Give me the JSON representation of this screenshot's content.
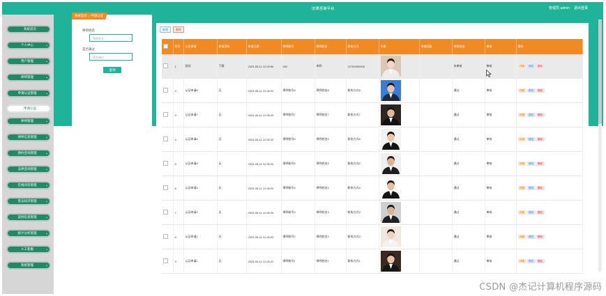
{
  "header": {
    "site_title": "法律咨询平台",
    "admin_label": "管理员 admin",
    "logout": "退出登录"
  },
  "sidebar": {
    "items": [
      {
        "label": "系统首页",
        "chevron": false,
        "active": false
      },
      {
        "label": "个人中心",
        "chevron": true,
        "active": false
      },
      {
        "label": "用户管理",
        "chevron": true,
        "active": false
      },
      {
        "label": "律师管理",
        "chevron": true,
        "active": false
      },
      {
        "label": "申请认证管理",
        "chevron": true,
        "active": false
      },
      {
        "label": "申请认证",
        "chevron": false,
        "active": true
      },
      {
        "label": "律师管理",
        "chevron": true,
        "active": false
      },
      {
        "label": "律师信息管理",
        "chevron": true,
        "active": false
      },
      {
        "label": "预约咨询管理",
        "chevron": true,
        "active": false
      },
      {
        "label": "法律咨询管理",
        "chevron": true,
        "active": false
      },
      {
        "label": "在线问答管理",
        "chevron": true,
        "active": false
      },
      {
        "label": "普法知识管理",
        "chevron": true,
        "active": false
      },
      {
        "label": "案例信息管理",
        "chevron": true,
        "active": false
      },
      {
        "label": "统计分析管理",
        "chevron": true,
        "active": false
      },
      {
        "label": "人工客服",
        "chevron": true,
        "active": false
      },
      {
        "label": "系统管理",
        "chevron": true,
        "active": false
      }
    ]
  },
  "breadcrumb": {
    "home": "系统首页",
    "separator": "/",
    "current": "申请认证"
  },
  "filters": {
    "field1_label": "律师姓名",
    "field1_placeholder": "律师姓名",
    "field2_label": "是否通过",
    "field2_placeholder": "是否通过",
    "search_button": "查询"
  },
  "toolbar": {
    "add": "新增",
    "delete": "删除"
  },
  "table": {
    "headers": [
      "",
      "序号",
      "认证申请",
      "申请资料",
      "申请日期",
      "律师账号",
      "律师姓名",
      "联系方式",
      "头像",
      "审核回复",
      "审核状态",
      "审核",
      "操作"
    ],
    "rows": [
      {
        "no": "1",
        "title": "测试",
        "material": "下载",
        "date": "2023-05-11 12:29:56",
        "account": "002",
        "name": "李四",
        "phone": "12700000005",
        "reply": "",
        "status": "未审核",
        "audit": "审核"
      },
      {
        "no": "2",
        "title": "认证申请8",
        "material": "无",
        "date": "2023-05-11 12:26:20",
        "account": "律师账号8",
        "name": "律师姓名8",
        "phone": "联系方式8",
        "reply": "",
        "status": "通过",
        "audit": "审核"
      },
      {
        "no": "3",
        "title": "认证申请7",
        "material": "无",
        "date": "2023-05-11 12:26:20",
        "account": "律师账号7",
        "name": "律师姓名7",
        "phone": "联系方式7",
        "reply": "",
        "status": "通过",
        "audit": "审核"
      },
      {
        "no": "4",
        "title": "认证申请6",
        "material": "无",
        "date": "2023-05-11 12:26:20",
        "account": "律师账号6",
        "name": "律师姓名6",
        "phone": "联系方式6",
        "reply": "",
        "status": "通过",
        "audit": "审核"
      },
      {
        "no": "5",
        "title": "认证申请5",
        "material": "无",
        "date": "2023-05-11 12:26:20",
        "account": "律师账号5",
        "name": "律师姓名5",
        "phone": "联系方式5",
        "reply": "",
        "status": "通过",
        "audit": "审核"
      },
      {
        "no": "6",
        "title": "认证申请4",
        "material": "无",
        "date": "2023-05-11 12:26:20",
        "account": "律师账号4",
        "name": "律师姓名4",
        "phone": "联系方式4",
        "reply": "",
        "status": "通过",
        "audit": "审核"
      },
      {
        "no": "7",
        "title": "认证申请3",
        "material": "无",
        "date": "2023-05-11 12:26:20",
        "account": "律师账号3",
        "name": "律师姓名3",
        "phone": "联系方式3",
        "reply": "",
        "status": "通过",
        "audit": "审核"
      },
      {
        "no": "8",
        "title": "认证申请2",
        "material": "无",
        "date": "2023-05-11 12:26:20",
        "account": "律师账号2",
        "name": "律师姓名2",
        "phone": "联系方式2",
        "reply": "",
        "status": "通过",
        "audit": "审核"
      },
      {
        "no": "9",
        "title": "认证申请1",
        "material": "无",
        "date": "2023-05-11 12:26:20",
        "account": "律师账号1",
        "name": "律师姓名1",
        "phone": "联系方式1",
        "reply": "",
        "status": "通过",
        "audit": "审核"
      }
    ],
    "ops": {
      "detail": "详情",
      "edit": "修改",
      "delete": "删除"
    }
  },
  "colors": {
    "teal": "#1fb39a",
    "orange": "#f08a24",
    "sidebar_green": "#1e8a66"
  },
  "icons": {
    "photo": "avatar-photo-icon",
    "cursor": "mouse-cursor-icon",
    "chevron": "chevron-down-icon"
  },
  "watermark": "CSDN @杰记计算机程序源码"
}
